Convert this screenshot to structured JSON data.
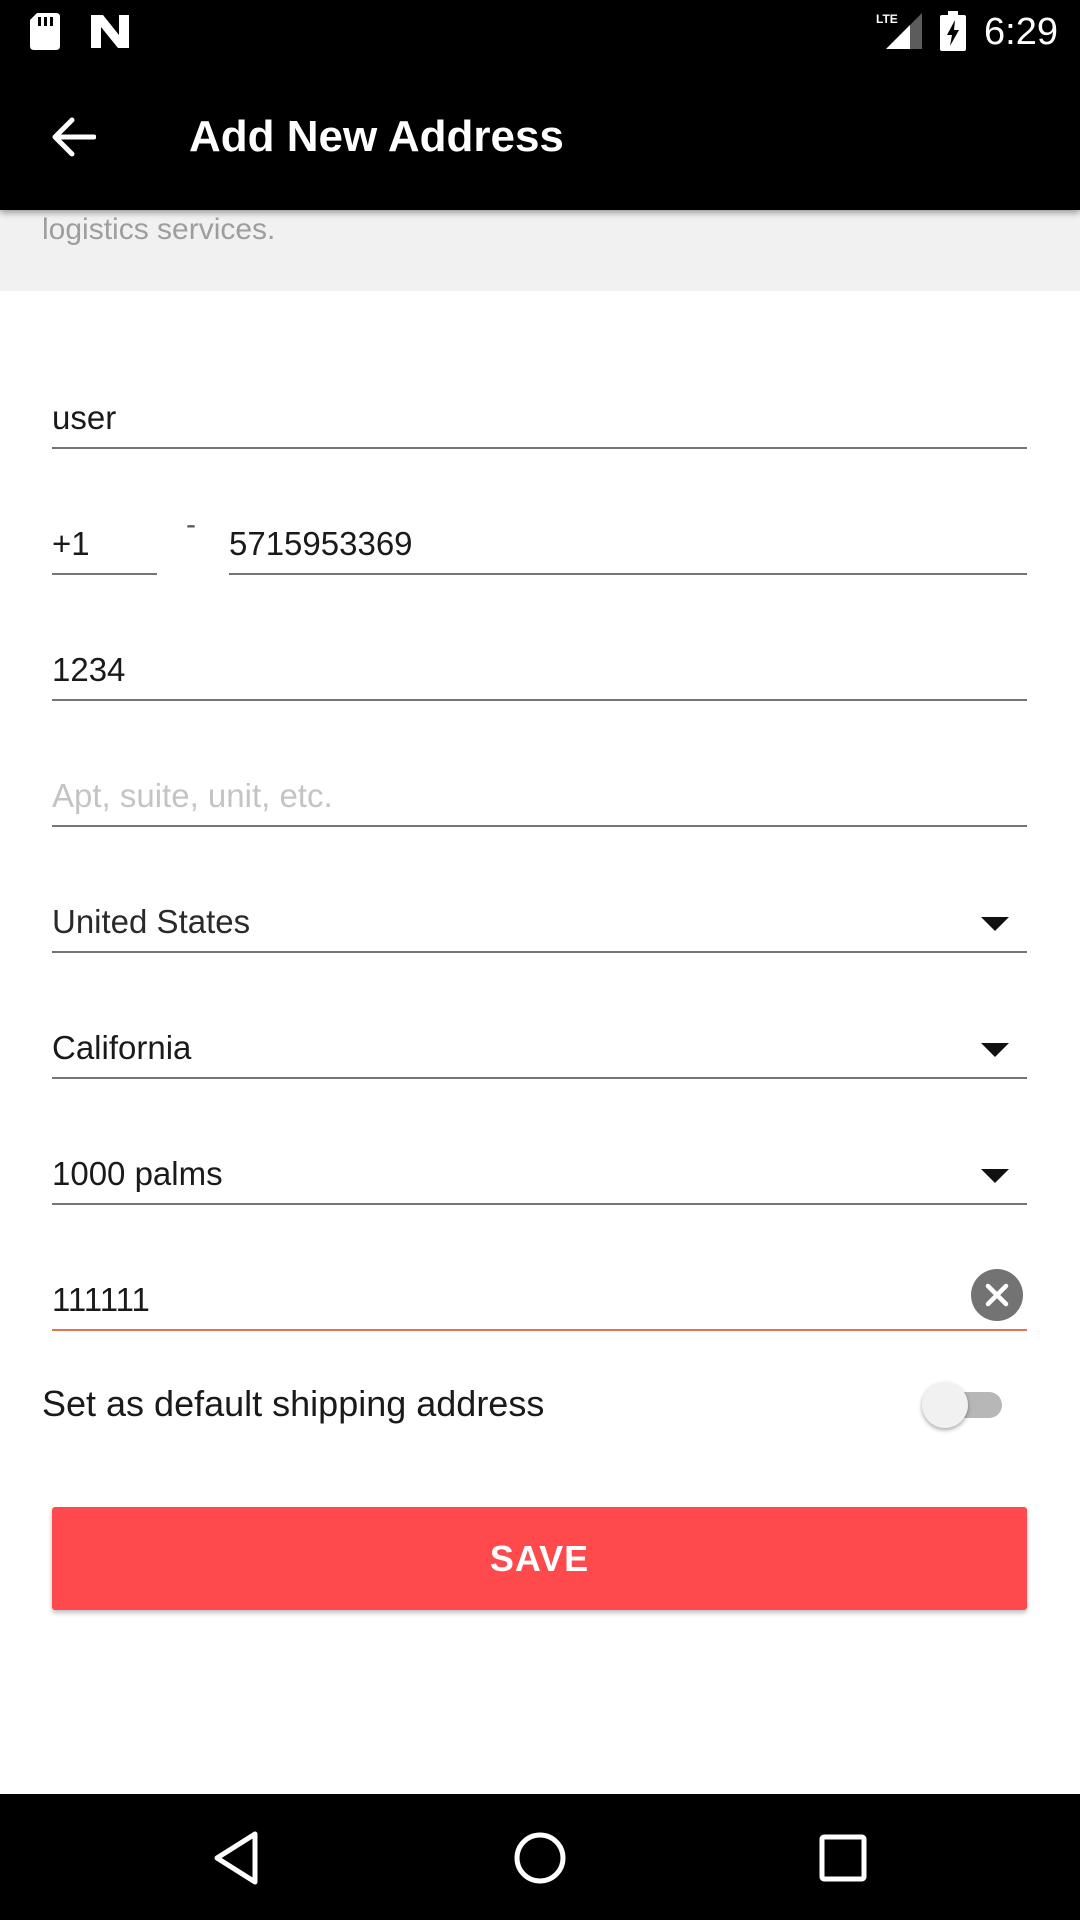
{
  "status_bar": {
    "time": "6:29",
    "network_label": "LTE",
    "icons": [
      "sd-card-icon",
      "n-notification-icon",
      "lte-signal-icon",
      "battery-charging-icon"
    ]
  },
  "app_bar": {
    "title": "Add New Address",
    "back_icon": "arrow-back-icon"
  },
  "notice": {
    "text": "logistics services."
  },
  "form": {
    "name": {
      "value": "user"
    },
    "phone": {
      "country_code": "+1",
      "separator": "-",
      "number": "5715953369"
    },
    "address_line1": {
      "value": "1234"
    },
    "address_line2": {
      "value": "",
      "placeholder": "Apt, suite, unit, etc."
    },
    "country": {
      "value": "United States"
    },
    "state": {
      "value": "California"
    },
    "city": {
      "value": "1000 palms"
    },
    "zip": {
      "value": "111111"
    },
    "default_shipping": {
      "label": "Set as default shipping address",
      "enabled": false
    }
  },
  "save_button": {
    "label": "SAVE"
  },
  "nav_bar": {
    "icons": [
      "back-triangle-icon",
      "home-circle-icon",
      "recents-square-icon"
    ]
  },
  "colors": {
    "accent": "#fe4a4c",
    "active_underline": "#e8704f",
    "bar_background": "#000000",
    "notice_background": "#f1f1f1"
  }
}
